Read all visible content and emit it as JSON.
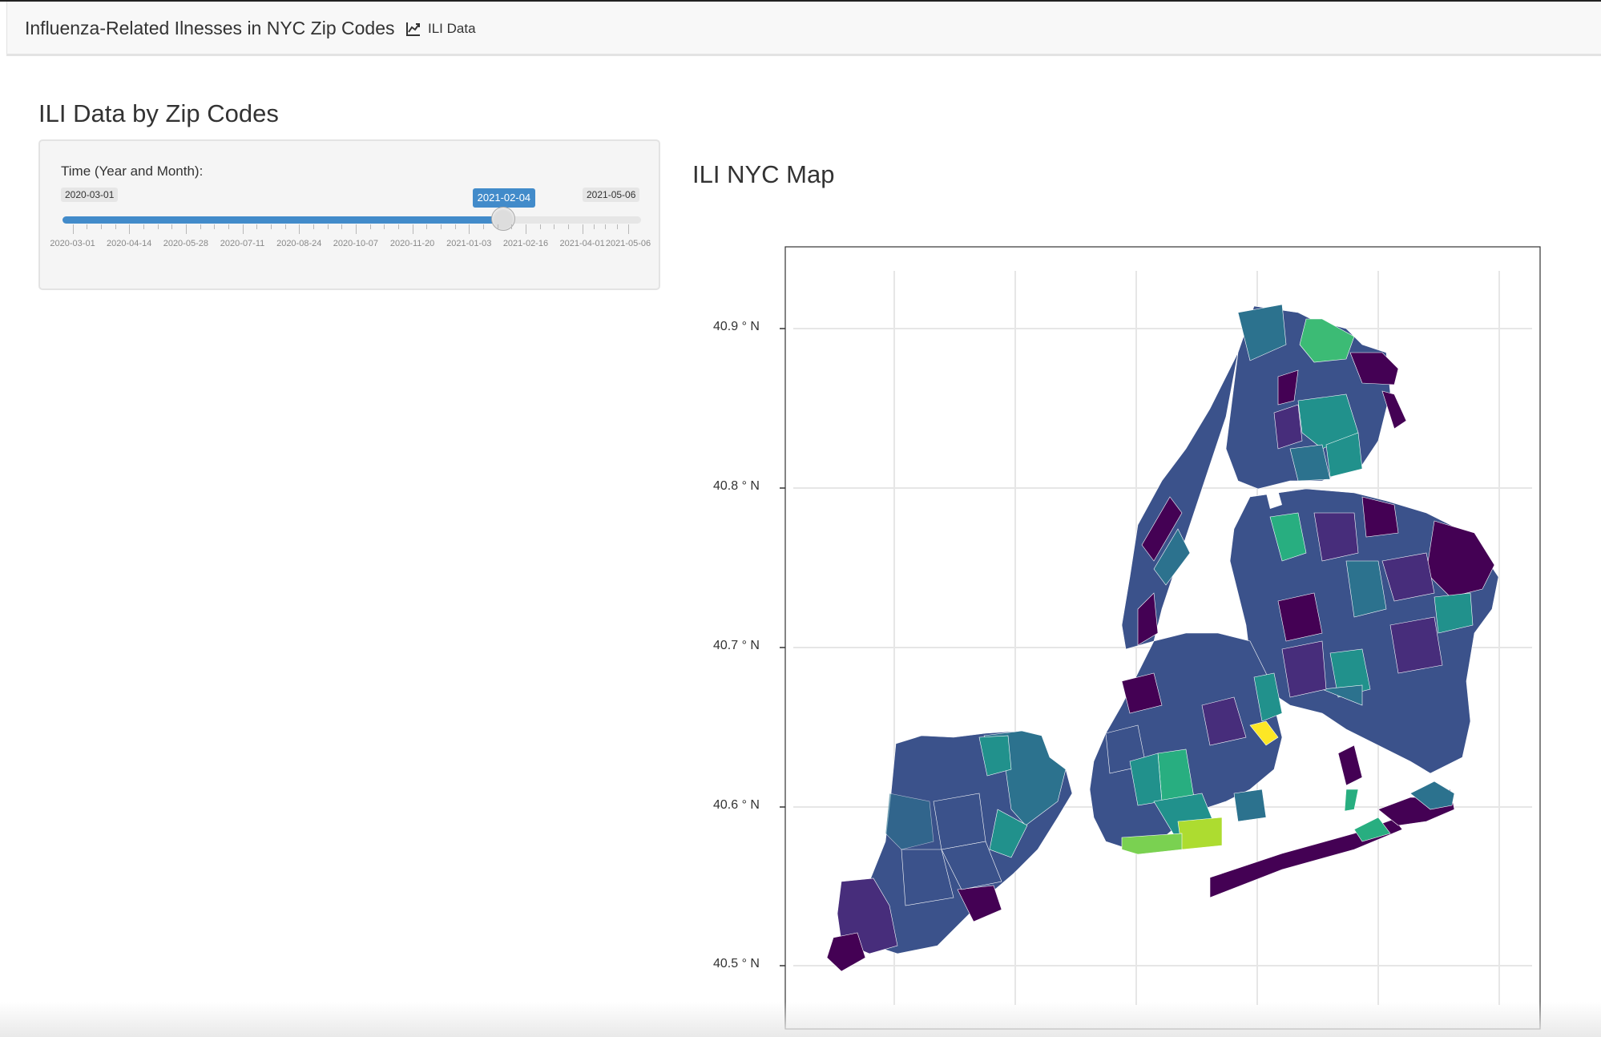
{
  "navbar": {
    "brand": "Influenza-Related Ilnesses in NYC Zip Codes",
    "tab_label": "ILI Data",
    "tab_icon": "line-chart-icon"
  },
  "page": {
    "title": "ILI Data by Zip Codes"
  },
  "slider": {
    "label": "Time (Year and Month):",
    "min_label": "2020-03-01",
    "max_label": "2021-05-06",
    "value_label": "2021-02-04",
    "value_fraction": 0.7613,
    "tick_labels": [
      "2020-03-01",
      "2020-04-14",
      "2020-05-28",
      "2020-07-11",
      "2020-08-24",
      "2020-10-07",
      "2020-11-20",
      "2021-01-03",
      "2021-02-16",
      "2021-04-01",
      "2021-05-06"
    ],
    "accent_color": "#428bca"
  },
  "map": {
    "title": "ILI NYC Map",
    "y_ticks": [
      "40.9 ° N",
      "40.8 ° N",
      "40.7 ° N",
      "40.6 ° N",
      "40.5 ° N"
    ],
    "palette": [
      "#440154",
      "#472d7b",
      "#3b528b",
      "#2c728e",
      "#21918c",
      "#28ae80",
      "#5ec962",
      "#addc30",
      "#fde725"
    ]
  }
}
